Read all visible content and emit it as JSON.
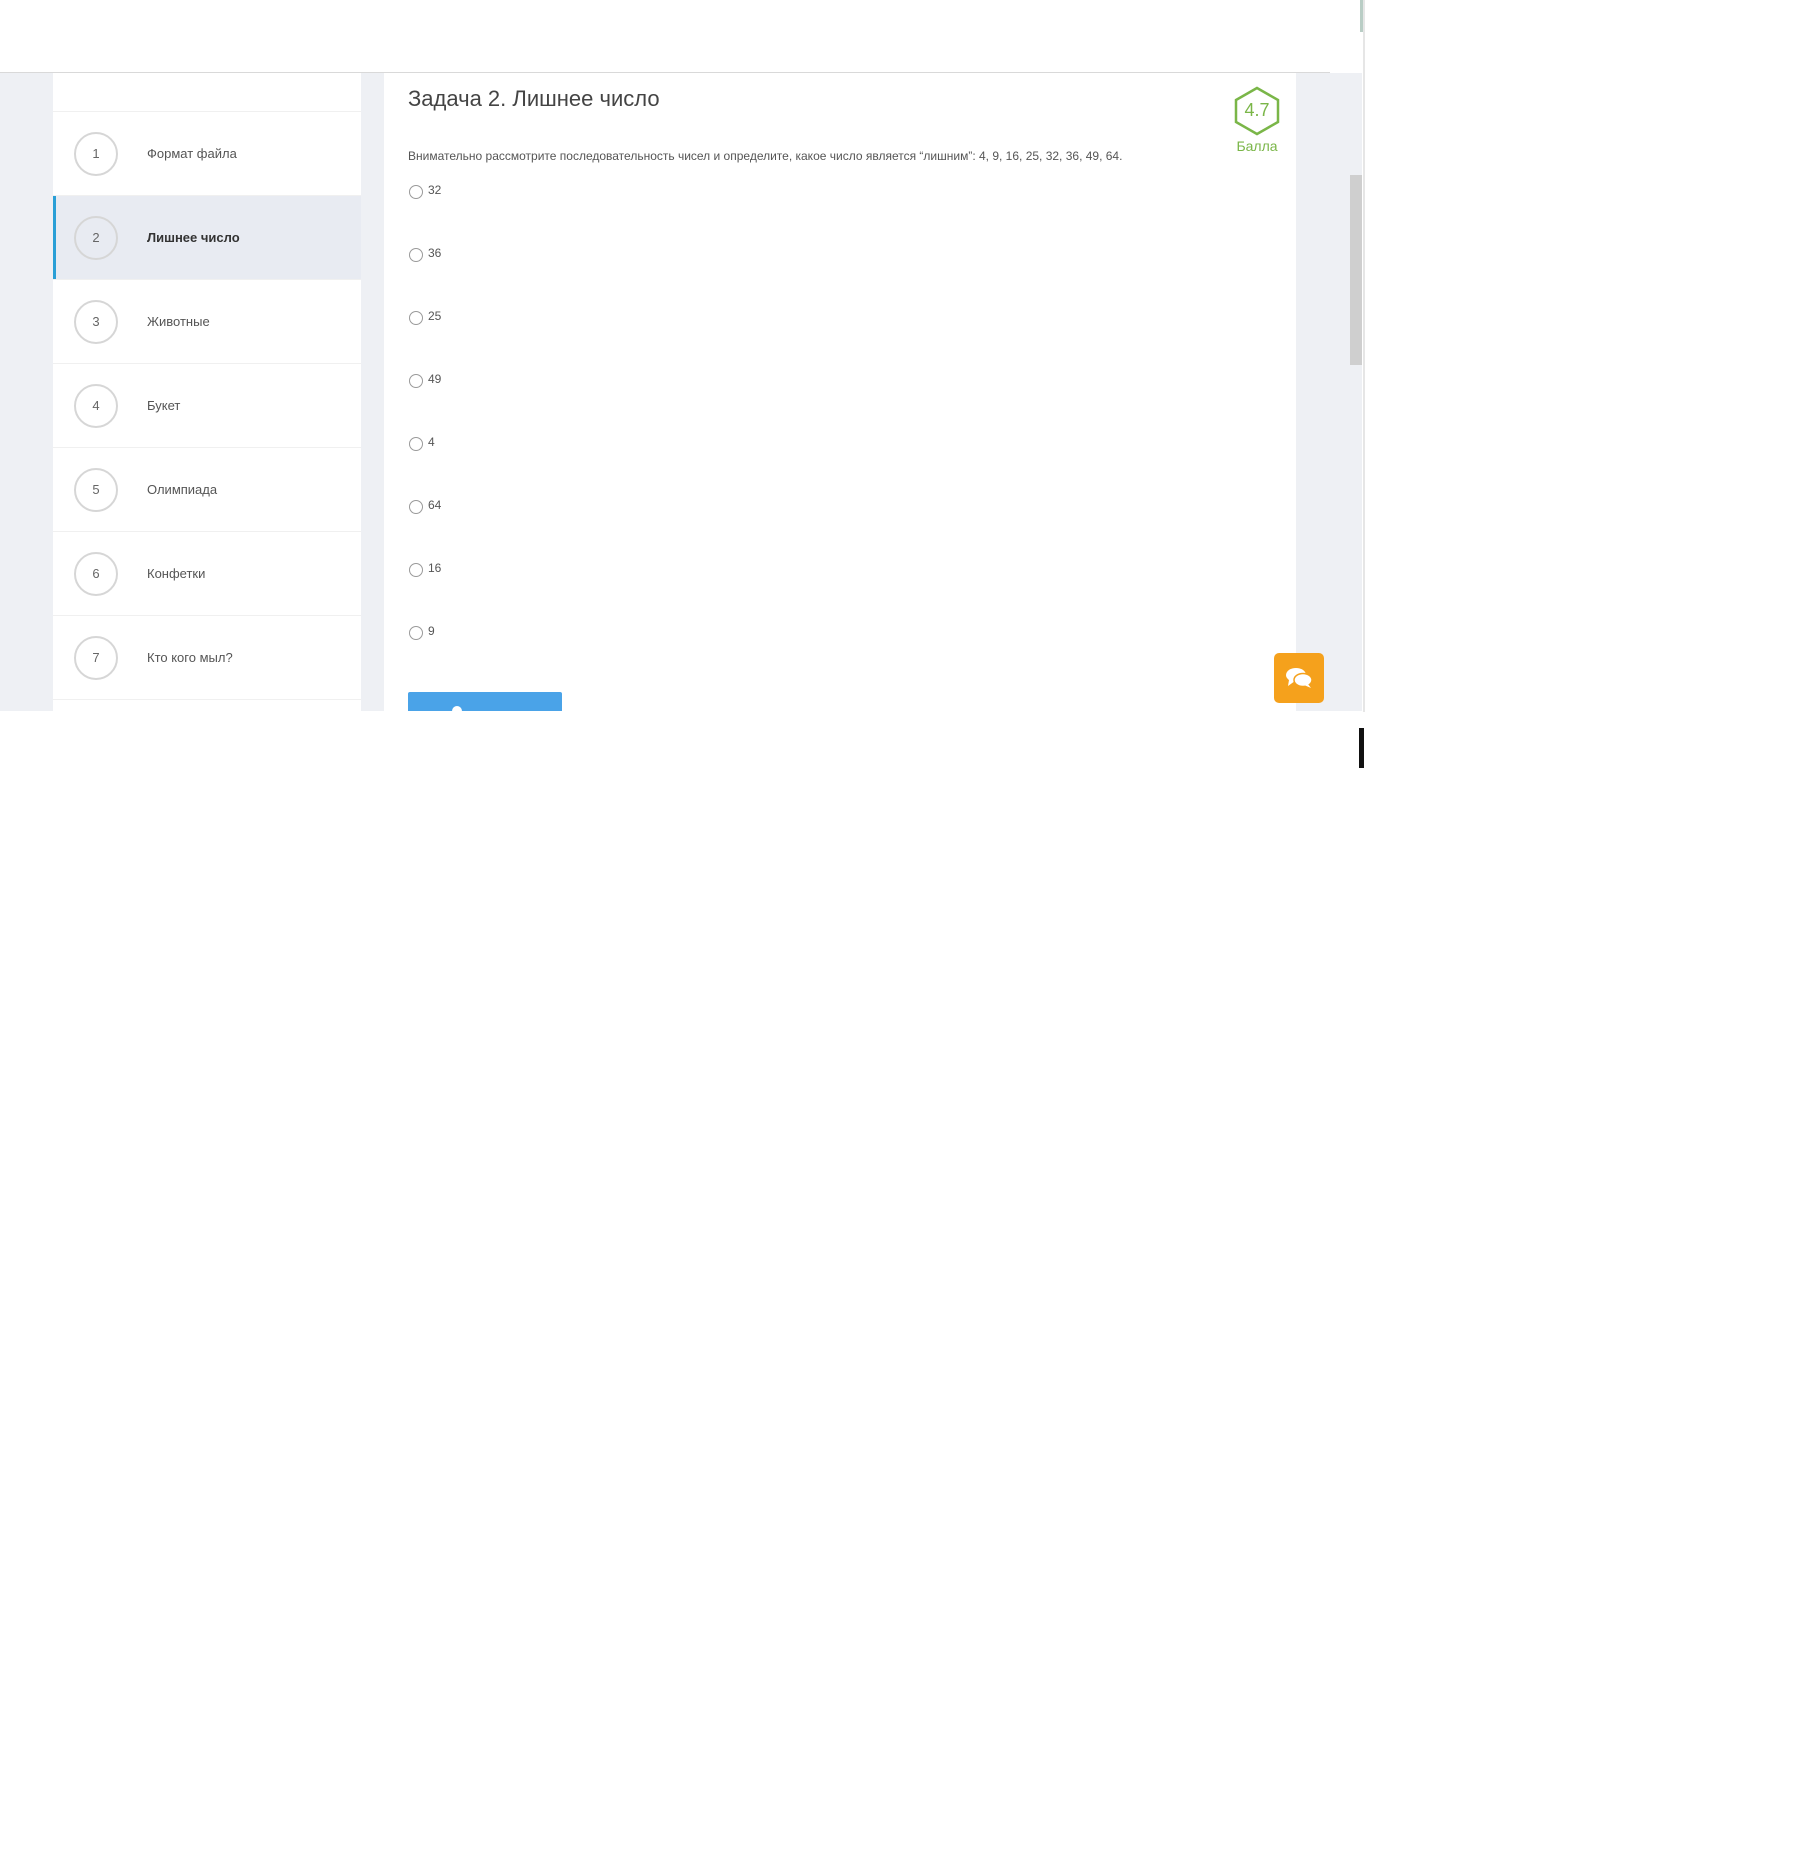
{
  "sidebar": {
    "items": [
      {
        "number": "1",
        "label": "Формат файла"
      },
      {
        "number": "2",
        "label": "Лишнее число"
      },
      {
        "number": "3",
        "label": "Животные"
      },
      {
        "number": "4",
        "label": "Букет"
      },
      {
        "number": "5",
        "label": "Олимпиада"
      },
      {
        "number": "6",
        "label": "Конфетки"
      },
      {
        "number": "7",
        "label": "Кто кого мыл?"
      }
    ],
    "active_index": 1
  },
  "task": {
    "title": "Задача 2. Лишнее число",
    "text": "Внимательно рассмотрите последовательность чисел и определите, какое число является “лишним”: 4, 9, 16, 25, 32, 36, 49, 64.",
    "score_value": "4.7",
    "score_label": "Балла",
    "options": [
      "32",
      "36",
      "25",
      "49",
      "4",
      "64",
      "16",
      "9"
    ]
  },
  "colors": {
    "accent": "#2a9fd6",
    "score": "#7ab648",
    "button": "#4aa3e8",
    "chat": "#f5a11c"
  },
  "icons": {
    "score_badge": "hexagon-icon",
    "chat": "chat-bubbles-icon"
  }
}
